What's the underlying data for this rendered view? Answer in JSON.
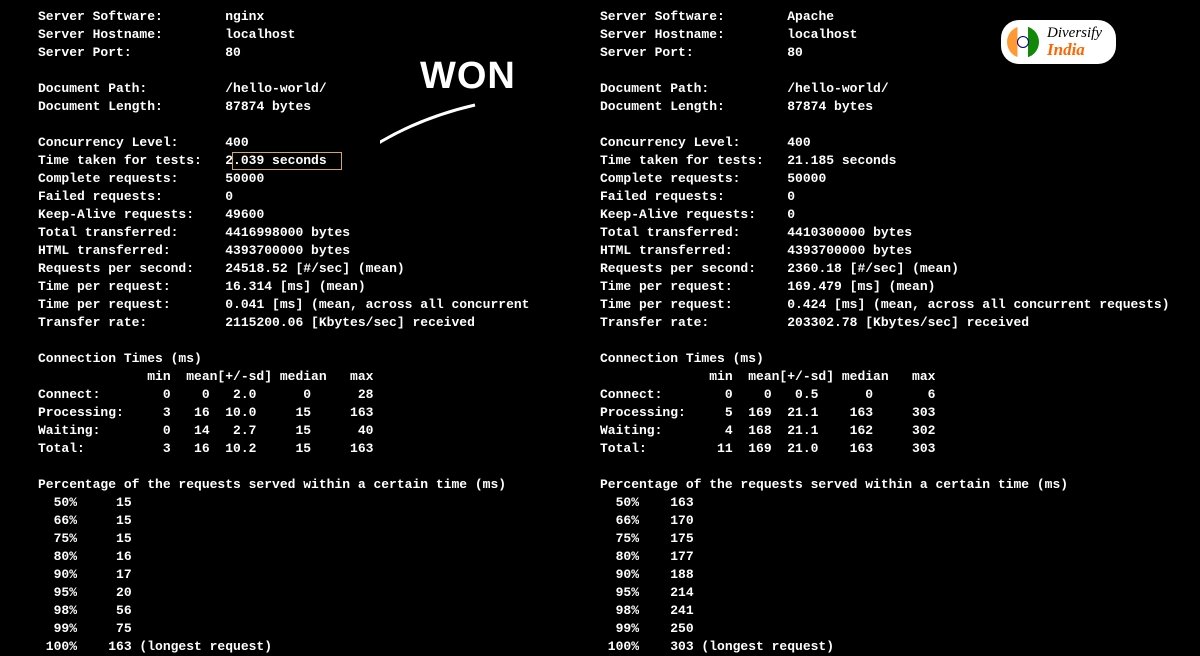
{
  "badge": {
    "line1": "Diversify",
    "line2": "India"
  },
  "annotation": {
    "won": "WON"
  },
  "left": {
    "server_software_label": "Server Software:",
    "server_software": "nginx",
    "server_hostname_label": "Server Hostname:",
    "server_hostname": "localhost",
    "server_port_label": "Server Port:",
    "server_port": "80",
    "document_path_label": "Document Path:",
    "document_path": "/hello-world/",
    "document_length_label": "Document Length:",
    "document_length": "87874 bytes",
    "concurrency_level_label": "Concurrency Level:",
    "concurrency_level": "400",
    "time_taken_label": "Time taken for tests:",
    "time_taken": "2.039 seconds",
    "complete_requests_label": "Complete requests:",
    "complete_requests": "50000",
    "failed_requests_label": "Failed requests:",
    "failed_requests": "0",
    "keep_alive_label": "Keep-Alive requests:",
    "keep_alive": "49600",
    "total_transferred_label": "Total transferred:",
    "total_transferred": "4416998000 bytes",
    "html_transferred_label": "HTML transferred:",
    "html_transferred": "4393700000 bytes",
    "rps_label": "Requests per second:",
    "rps": "24518.52 [#/sec] (mean)",
    "tpr1_label": "Time per request:",
    "tpr1": "16.314 [ms] (mean)",
    "tpr2_label": "Time per request:",
    "tpr2": "0.041 [ms] (mean, across all concurrent",
    "transfer_rate_label": "Transfer rate:",
    "transfer_rate": "2115200.06 [Kbytes/sec] received",
    "conn_times_header": "Connection Times (ms)",
    "conn_cols": "              min  mean[+/-sd] median   max",
    "connect": "Connect:        0    0   2.0      0      28",
    "processing": "Processing:     3   16  10.0     15     163",
    "waiting": "Waiting:        0   14   2.7     15      40",
    "total": "Total:          3   16  10.2     15     163",
    "pct_header": "Percentage of the requests served within a certain time (ms)",
    "p50": "  50%     15",
    "p66": "  66%     15",
    "p75": "  75%     15",
    "p80": "  80%     16",
    "p90": "  90%     17",
    "p95": "  95%     20",
    "p98": "  98%     56",
    "p99": "  99%     75",
    "p100": " 100%    163 (longest request)"
  },
  "right": {
    "server_software_label": "Server Software:",
    "server_software": "Apache",
    "server_hostname_label": "Server Hostname:",
    "server_hostname": "localhost",
    "server_port_label": "Server Port:",
    "server_port": "80",
    "document_path_label": "Document Path:",
    "document_path": "/hello-world/",
    "document_length_label": "Document Length:",
    "document_length": "87874 bytes",
    "concurrency_level_label": "Concurrency Level:",
    "concurrency_level": "400",
    "time_taken_label": "Time taken for tests:",
    "time_taken": "21.185 seconds",
    "complete_requests_label": "Complete requests:",
    "complete_requests": "50000",
    "failed_requests_label": "Failed requests:",
    "failed_requests": "0",
    "keep_alive_label": "Keep-Alive requests:",
    "keep_alive": "0",
    "total_transferred_label": "Total transferred:",
    "total_transferred": "4410300000 bytes",
    "html_transferred_label": "HTML transferred:",
    "html_transferred": "4393700000 bytes",
    "rps_label": "Requests per second:",
    "rps": "2360.18 [#/sec] (mean)",
    "tpr1_label": "Time per request:",
    "tpr1": "169.479 [ms] (mean)",
    "tpr2_label": "Time per request:",
    "tpr2": "0.424 [ms] (mean, across all concurrent requests)",
    "transfer_rate_label": "Transfer rate:",
    "transfer_rate": "203302.78 [Kbytes/sec] received",
    "conn_times_header": "Connection Times (ms)",
    "conn_cols": "              min  mean[+/-sd] median   max",
    "connect": "Connect:        0    0   0.5      0       6",
    "processing": "Processing:     5  169  21.1    163     303",
    "waiting": "Waiting:        4  168  21.1    162     302",
    "total": "Total:         11  169  21.0    163     303",
    "pct_header": "Percentage of the requests served within a certain time (ms)",
    "p50": "  50%    163",
    "p66": "  66%    170",
    "p75": "  75%    175",
    "p80": "  80%    177",
    "p90": "  90%    188",
    "p95": "  95%    214",
    "p98": "  98%    241",
    "p99": "  99%    250",
    "p100": " 100%    303 (longest request)"
  }
}
